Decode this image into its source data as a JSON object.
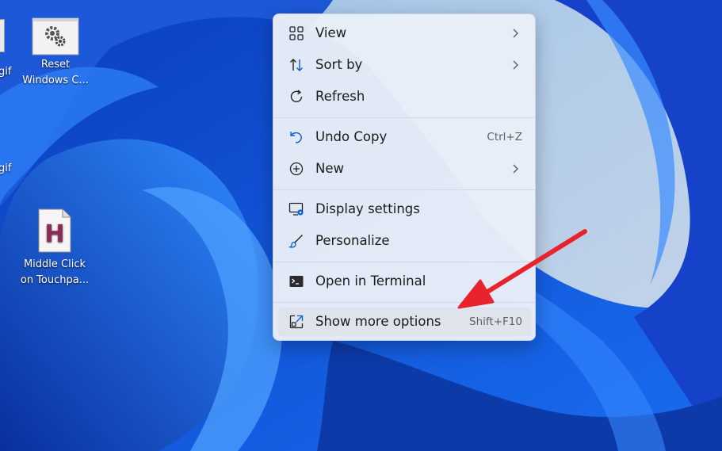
{
  "desktop": {
    "icons": [
      {
        "label_line1": "Reset",
        "label_line2": "Windows C..."
      },
      {
        "label_line1": "Middle Click",
        "label_line2": "on Touchpa...",
        "glyph": "H"
      }
    ],
    "partial_labels": [
      "gif",
      "gif"
    ]
  },
  "menu": {
    "items": [
      {
        "label": "View",
        "icon": "grid-icon",
        "shortcut": "",
        "submenu": true
      },
      {
        "label": "Sort by",
        "icon": "sort-icon",
        "shortcut": "",
        "submenu": true
      },
      {
        "label": "Refresh",
        "icon": "refresh-icon",
        "shortcut": "",
        "submenu": false
      },
      {
        "label": "Undo Copy",
        "icon": "undo-icon",
        "shortcut": "Ctrl+Z",
        "submenu": false
      },
      {
        "label": "New",
        "icon": "plus-circle-icon",
        "shortcut": "",
        "submenu": true
      },
      {
        "label": "Display settings",
        "icon": "display-settings-icon",
        "shortcut": "",
        "submenu": false
      },
      {
        "label": "Personalize",
        "icon": "brush-icon",
        "shortcut": "",
        "submenu": false
      },
      {
        "label": "Open in Terminal",
        "icon": "terminal-icon",
        "shortcut": "",
        "submenu": false
      },
      {
        "label": "Show more options",
        "icon": "expand-icon",
        "shortcut": "Shift+F10",
        "submenu": false
      }
    ]
  },
  "colors": {
    "accent": "#0b5bd3",
    "annotation_arrow": "#e8232b"
  }
}
